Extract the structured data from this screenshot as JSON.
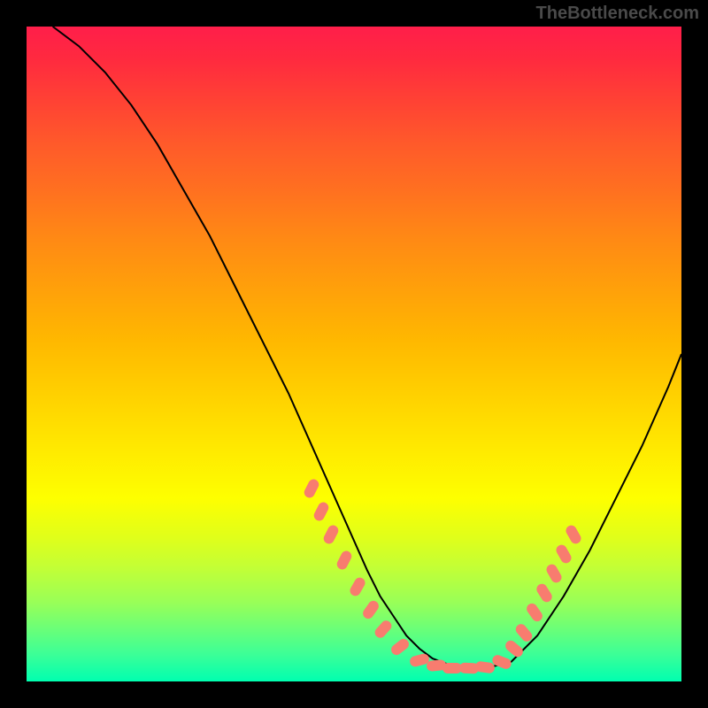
{
  "watermark": "TheBottleneck.com",
  "chart_data": {
    "type": "line",
    "title": "",
    "xlabel": "",
    "ylabel": "",
    "xlim": [
      0,
      100
    ],
    "ylim": [
      0,
      100
    ],
    "grid": false,
    "series": [
      {
        "name": "curve",
        "x": [
          4,
          8,
          12,
          16,
          20,
          24,
          28,
          32,
          36,
          40,
          44,
          48,
          52,
          54,
          56,
          58,
          60,
          62,
          66,
          70,
          74,
          78,
          82,
          86,
          90,
          94,
          98,
          100
        ],
        "y": [
          100,
          97,
          93,
          88,
          82,
          75,
          68,
          60,
          52,
          44,
          35,
          26,
          17,
          13,
          10,
          7,
          5,
          3.5,
          2,
          2,
          3,
          7,
          13,
          20,
          28,
          36,
          45,
          50
        ]
      }
    ],
    "markers_left": [
      {
        "cx": 43.5,
        "cy": 29.5,
        "angle": -63
      },
      {
        "cx": 45.0,
        "cy": 26.0,
        "angle": -63
      },
      {
        "cx": 46.5,
        "cy": 22.5,
        "angle": -63
      },
      {
        "cx": 48.5,
        "cy": 18.5,
        "angle": -63
      },
      {
        "cx": 50.5,
        "cy": 14.5,
        "angle": -60
      },
      {
        "cx": 52.5,
        "cy": 11.0,
        "angle": -55
      },
      {
        "cx": 54.5,
        "cy": 8.0,
        "angle": -48
      },
      {
        "cx": 57.0,
        "cy": 5.3,
        "angle": -38
      }
    ],
    "markers_bottom": [
      {
        "cx": 60.0,
        "cy": 3.2,
        "angle": -15
      },
      {
        "cx": 62.5,
        "cy": 2.4,
        "angle": -6
      },
      {
        "cx": 65.0,
        "cy": 2.0,
        "angle": 0
      },
      {
        "cx": 67.5,
        "cy": 2.0,
        "angle": 3
      },
      {
        "cx": 70.0,
        "cy": 2.1,
        "angle": 8
      }
    ],
    "markers_right": [
      {
        "cx": 72.5,
        "cy": 3.0,
        "angle": 22
      },
      {
        "cx": 74.5,
        "cy": 5.0,
        "angle": 40
      },
      {
        "cx": 76.0,
        "cy": 7.5,
        "angle": 50
      },
      {
        "cx": 77.5,
        "cy": 10.5,
        "angle": 55
      },
      {
        "cx": 79.0,
        "cy": 13.5,
        "angle": 58
      },
      {
        "cx": 80.5,
        "cy": 16.5,
        "angle": 60
      },
      {
        "cx": 82.0,
        "cy": 19.5,
        "angle": 60
      },
      {
        "cx": 83.5,
        "cy": 22.5,
        "angle": 60
      }
    ],
    "background_gradient": {
      "top": "#ff1e4a",
      "mid": "#ffd000",
      "bottom": "#00ffb0"
    }
  }
}
